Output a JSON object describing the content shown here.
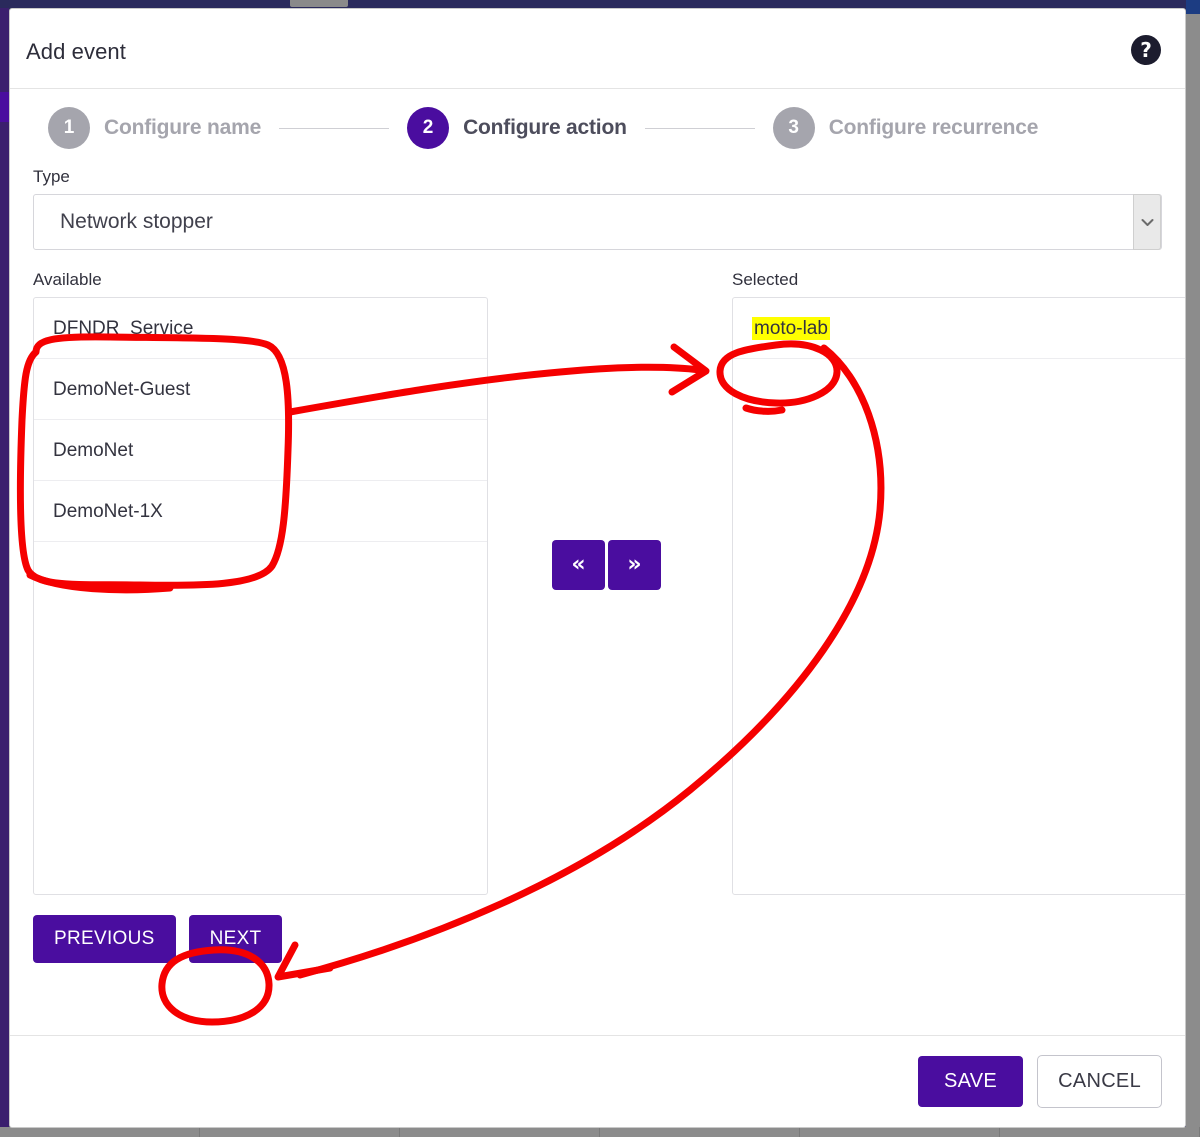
{
  "window": {
    "title": "Add event",
    "help_icon": "help-circle-icon"
  },
  "stepper": {
    "steps": [
      {
        "number": "1",
        "label": "Configure name",
        "state": "inactive"
      },
      {
        "number": "2",
        "label": "Configure action",
        "state": "active"
      },
      {
        "number": "3",
        "label": "Configure recurrence",
        "state": "inactive"
      }
    ]
  },
  "form": {
    "type": {
      "label": "Type",
      "value": "Network stopper",
      "dropdown_icon": "chevron-down-icon"
    },
    "available": {
      "label": "Available",
      "items": [
        "DFNDR_Service",
        "DemoNet-Guest",
        "DemoNet",
        "DemoNet-1X"
      ]
    },
    "selected": {
      "label": "Selected",
      "items": [
        "moto-lab"
      ]
    },
    "transfer": {
      "move_left_label": "«",
      "move_right_label": "»",
      "move_left_icon": "double-chevron-left-icon",
      "move_right_icon": "double-chevron-right-icon"
    }
  },
  "wizard_nav": {
    "previous_label": "PREVIOUS",
    "next_label": "NEXT"
  },
  "footer": {
    "save_label": "SAVE",
    "cancel_label": "CANCEL"
  },
  "colors": {
    "accent_purple": "#4a0d9f",
    "step_inactive_grey": "#a5a5ad",
    "annotation_red": "#f50000",
    "highlight_yellow": "#ffff00",
    "backdrop_navy": "#2a2a57"
  },
  "annotations": {
    "items": [
      {
        "name": "circle-available-list",
        "shape": "rounded-rect-circle"
      },
      {
        "name": "arrow-available-to-selected",
        "shape": "arrow"
      },
      {
        "name": "circle-selected-moto-lab",
        "shape": "ellipse"
      },
      {
        "name": "curve-selected-to-next",
        "shape": "curved-arrow"
      },
      {
        "name": "circle-next-button",
        "shape": "ellipse"
      },
      {
        "name": "highlight-moto-lab",
        "shape": "marker-highlight"
      }
    ]
  }
}
